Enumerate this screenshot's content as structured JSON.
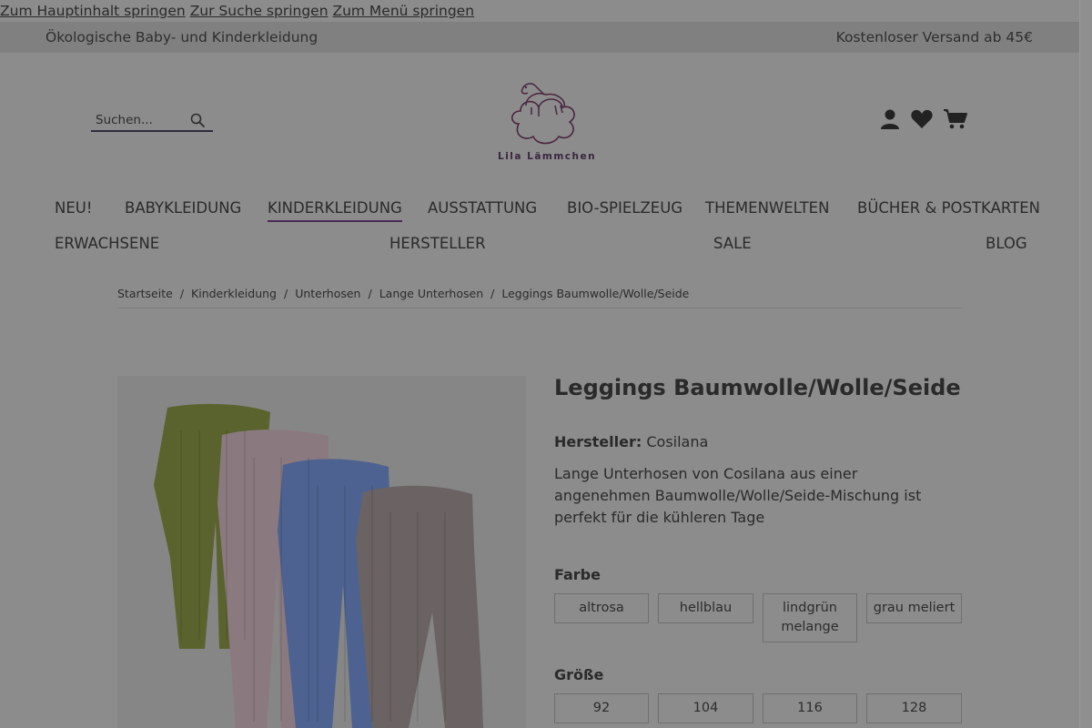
{
  "skip_links": {
    "main": "Zum Hauptinhalt springen",
    "search": "Zur Suche springen",
    "menu": "Zum Menü springen"
  },
  "topbar": {
    "left": "Ökologische Baby- und Kinderkleidung",
    "right": "Kostenloser Versand ab 45€"
  },
  "search": {
    "placeholder": "Suchen..."
  },
  "logo": {
    "text": "Lila Lämmchen"
  },
  "nav": {
    "row1": [
      "NEU!",
      "BABYKLEIDUNG",
      "KINDERKLEIDUNG",
      "AUSSTATTUNG",
      "BIO-SPIELZEUG",
      "THEMENWELTEN",
      "BÜCHER & POSTKARTEN"
    ],
    "row2": [
      "ERWACHSENE",
      "HERSTELLER",
      "SALE",
      "BLOG"
    ]
  },
  "breadcrumb": [
    "Startseite",
    "Kinderkleidung",
    "Unterhosen",
    "Lange Unterhosen",
    "Leggings Baumwolle/Wolle/Seide"
  ],
  "product": {
    "title": "Leggings Baumwolle/Wolle/Seide",
    "maker_label": "Hersteller:",
    "maker": "Cosilana",
    "description": "Lange Unterhosen von Cosilana aus einer angenehmen Baumwolle/Wolle/Seide-Mischung ist perfekt für die kühleren Tage",
    "color_label": "Farbe",
    "colors": [
      "altrosa",
      "hellblau",
      "lindgrün melange",
      "grau meliert"
    ],
    "size_label": "Größe",
    "sizes": [
      "92",
      "104",
      "116",
      "128"
    ]
  },
  "colors": {
    "overlay_bg": "#8c8c8c",
    "topbar_bg": "#808080",
    "accent": "#4a2b52"
  }
}
